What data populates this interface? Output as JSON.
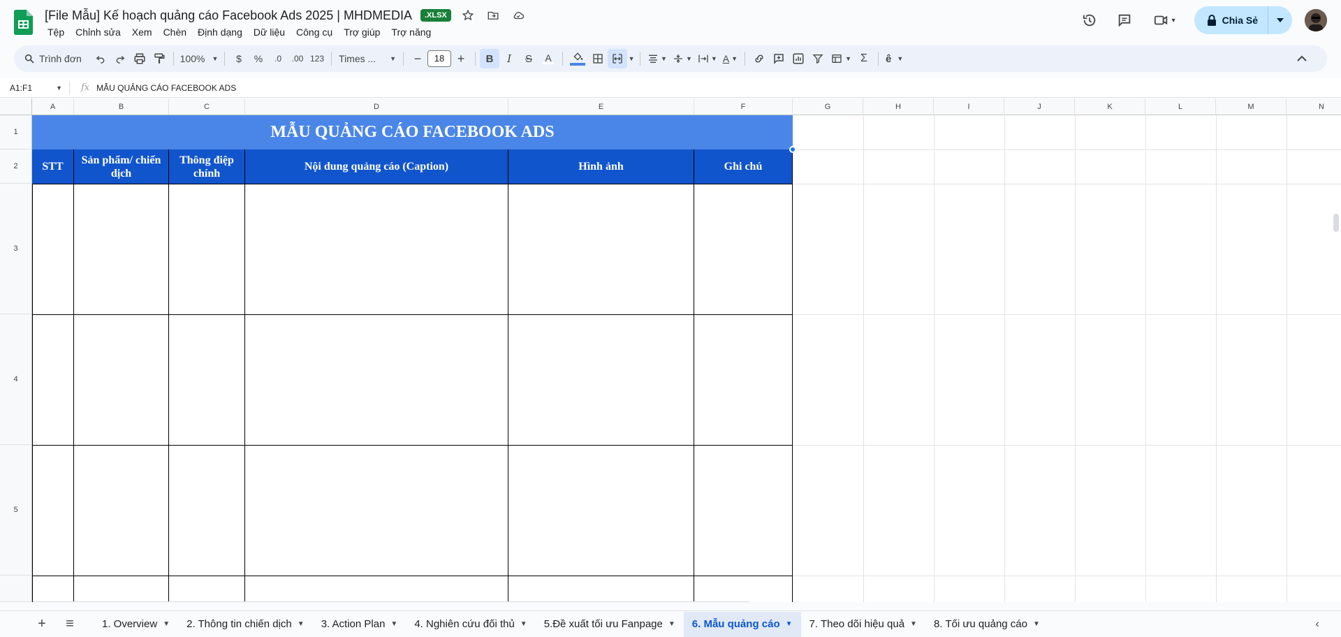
{
  "app": {
    "doc_title": "[File Mẫu] Kế hoạch quảng cáo Facebook Ads 2025 | MHDMEDIA",
    "file_badge": ".XLSX",
    "menu": [
      "Tệp",
      "Chỉnh sửa",
      "Xem",
      "Chèn",
      "Định dạng",
      "Dữ liệu",
      "Công cụ",
      "Trợ giúp",
      "Trợ năng"
    ],
    "share_label": "Chia Sẻ"
  },
  "toolbar": {
    "search_text": "Trình đơn",
    "zoom": "100%",
    "currency": "$",
    "percent": "%",
    "dec_decrease": ".0",
    "dec_increase": ".00",
    "number_format": "123",
    "font_name": "Times ...",
    "font_size": "18"
  },
  "formula_bar": {
    "name_box": "A1:F1",
    "fx": "fx",
    "content": "MẪU QUẢNG CÁO FACEBOOK ADS"
  },
  "grid": {
    "columns": [
      "A",
      "B",
      "C",
      "D",
      "E",
      "F",
      "G",
      "H",
      "I",
      "J",
      "K",
      "L",
      "M",
      "N"
    ],
    "rows": [
      "1",
      "2",
      "3",
      "4",
      "5"
    ],
    "title": "MẪU QUẢNG CÁO FACEBOOK ADS",
    "headers": {
      "a": "STT",
      "b": "Sản phẩm/ chiến dịch",
      "c": "Thông điệp chính",
      "d": "Nội dung quảng cáo (Caption)",
      "e": "Hình ảnh",
      "f": "Ghi chú"
    }
  },
  "sheet_tabs": [
    "1. Overview",
    "2. Thông tin chiến dịch",
    "3. Action Plan",
    "4. Nghiên cứu đối thủ",
    "5.Đề xuất tối ưu Fanpage",
    "6. Mẫu quảng cáo",
    "7. Theo dõi hiệu quả",
    "8. Tối ưu quảng cáo"
  ],
  "active_tab": "6. Mẫu quảng cáo",
  "colors": {
    "title_fill": "#4a86e8",
    "header_fill": "#1155cc",
    "accent": "#0b57d0",
    "badge": "#188038"
  }
}
